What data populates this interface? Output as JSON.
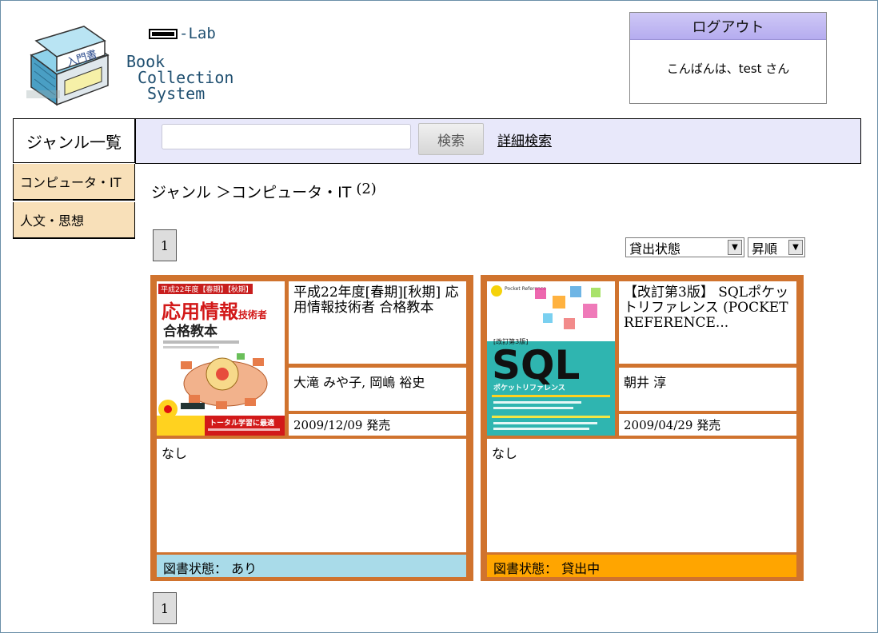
{
  "header": {
    "lab_name": "-Lab",
    "system_lines": [
      "Book",
      "Collection",
      "System"
    ],
    "logo_book_chars": "入門書"
  },
  "account": {
    "logout_label": "ログアウト",
    "greeting": "こんばんは、test さん"
  },
  "sidebar": {
    "title": "ジャンル一覧",
    "items": [
      {
        "label": "コンピュータ・IT"
      },
      {
        "label": "人文・思想"
      }
    ]
  },
  "search": {
    "value": "",
    "placeholder": "",
    "button_label": "検索",
    "advanced_label": "詳細検索"
  },
  "breadcrumb": {
    "path": "ジャンル ＞コンピュータ・IT",
    "count": "(2)"
  },
  "pagination": {
    "top_page": "1",
    "bottom_page": "1"
  },
  "sort": {
    "field": "貸出状態",
    "order": "昇順"
  },
  "books": [
    {
      "title": "平成22年度[春期][秋期] 応用情報技術者 合格教本",
      "authors": "大滝 みや子, 岡嶋 裕史",
      "date": "2009/12/09 発売",
      "note": "なし",
      "status": "図書状態： あり",
      "status_color": "#a9dbe9",
      "cover": {
        "tag": "平成22年度【春期】【秋期】",
        "main": "応用情報",
        "sub": "技術者",
        "line2": "合格教本",
        "band": "トータル学習に最適"
      }
    },
    {
      "title": "【改訂第3版】 SQLポケットリファレンス (POCKET REFERENCE...",
      "authors": "朝井 淳",
      "date": "2009/04/29 発売",
      "note": "なし",
      "status": "図書状態： 貸出中",
      "status_color": "#ffa500",
      "cover": {
        "series": "Pocket Reference",
        "edition": "[改訂第3版]",
        "main": "SQL",
        "sub": "ポケットリファレンス"
      }
    }
  ]
}
